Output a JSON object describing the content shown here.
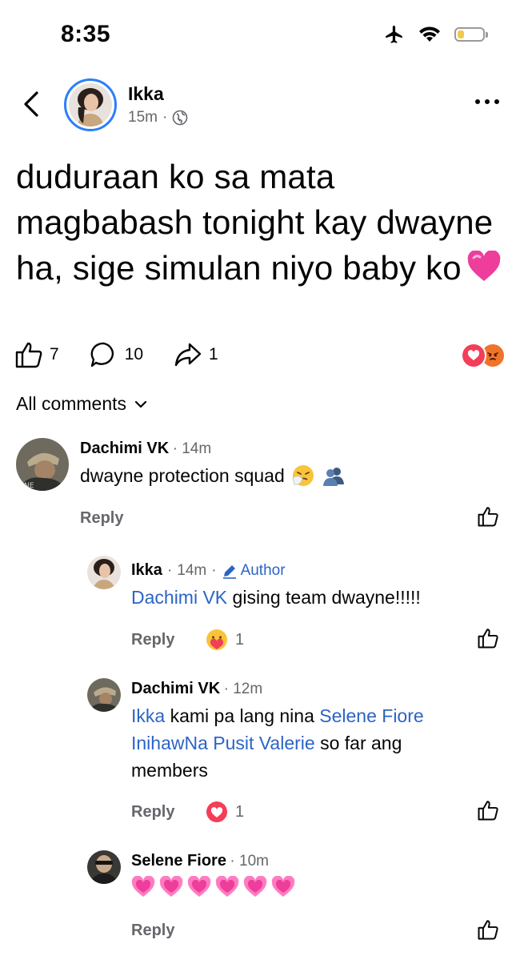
{
  "status_bar": {
    "time": "8:35"
  },
  "post": {
    "author": "Ikka",
    "age": "15m",
    "separator": "·",
    "text": "duduraan ko sa mata magbabash tonight kay dwayne ha, sige simulan niyo baby ko",
    "likes": "7",
    "comments": "10",
    "shares": "1"
  },
  "comments_header": {
    "label": "All comments"
  },
  "comments": [
    {
      "name": "Dachimi VK",
      "time": "14m",
      "text": "dwayne protection squad",
      "reply_label": "Reply"
    },
    {
      "name": "Ikka",
      "time": "14m",
      "author_label": "Author",
      "mention": "Dachimi VK",
      "text": " gising team dwayne!!!!!",
      "reply_label": "Reply",
      "reaction_count": "1"
    },
    {
      "name": "Dachimi VK",
      "time": "12m",
      "mention1": "Ikka",
      "text1": " kami pa lang nina ",
      "mention2": "Selene Fiore",
      "mention3": "InihawNa Pusit Valerie",
      "text2": " so far ang members",
      "reply_label": "Reply",
      "reaction_count": "1"
    },
    {
      "name": "Selene Fiore",
      "time": "10m",
      "reply_label": "Reply"
    }
  ],
  "colors": {
    "link": "#2b64c6",
    "muted": "#65676b",
    "love": "#f33e58",
    "angry": "#f0732b",
    "ring": "#2d7ff9"
  },
  "icons": [
    "airplane-icon",
    "wifi-icon",
    "battery-icon",
    "back-arrow-icon",
    "globe-icon",
    "more-icon",
    "like-icon",
    "comment-icon",
    "share-icon",
    "love-reaction-icon",
    "angry-reaction-icon",
    "chevron-down-icon",
    "pencil-icon",
    "care-reaction-icon",
    "heart-emoji-icon"
  ]
}
